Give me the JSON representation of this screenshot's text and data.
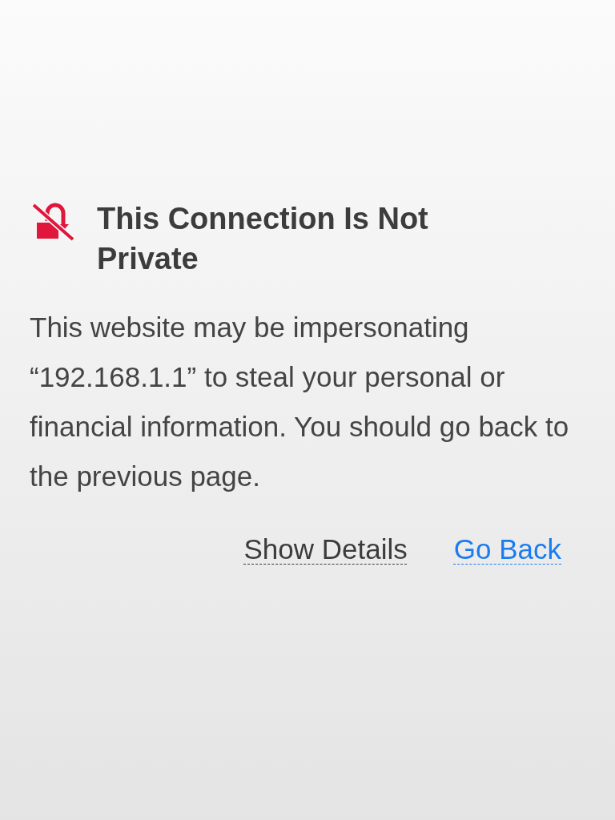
{
  "title": "This Connection Is Not Private",
  "message": "This website may be impersonating “192.168.1.1” to steal your personal or financial information. You should go back to the previous page.",
  "links": [
    {
      "label": "Show Details",
      "kind": "secondary"
    },
    {
      "label": "Go Back",
      "kind": "primary"
    }
  ]
}
